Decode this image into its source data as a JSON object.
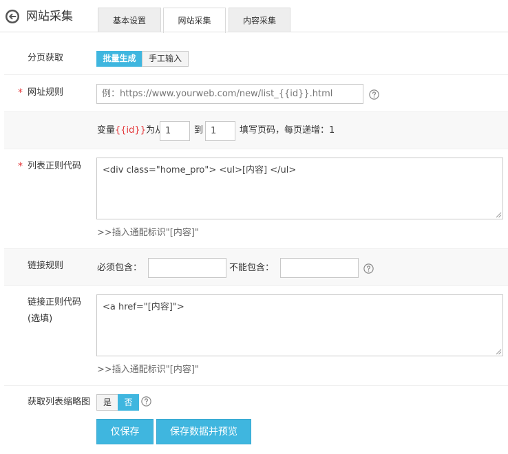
{
  "header": {
    "title": "网站采集",
    "tabs": [
      {
        "label": "基本设置"
      },
      {
        "label": "网站采集"
      },
      {
        "label": "内容采集"
      }
    ]
  },
  "paging": {
    "label": "分页获取",
    "options": [
      "批量生成",
      "手工输入"
    ],
    "selected": "批量生成"
  },
  "url_rule": {
    "required_mark": "*",
    "label": "网址规则",
    "placeholder": "例：https://www.yourweb.com/new/list_{{id}}.html"
  },
  "variable": {
    "prefix": "变量",
    "token": "{{id}}",
    "from_text": "为从",
    "from_value": "1",
    "to_text": "到",
    "to_value": "1",
    "suffix": "填写页码，每页递增：1"
  },
  "list_regex": {
    "required_mark": "*",
    "label": "列表正则代码",
    "value": "<div class=\"home_pro\"> <ul>[内容] </ul>",
    "hint": ">>插入通配标识\"[内容]\""
  },
  "link_rule": {
    "label": "链接规则",
    "must_include_label": "必须包含：",
    "must_include_value": "",
    "must_exclude_label": "不能包含：",
    "must_exclude_value": ""
  },
  "link_regex": {
    "label": "链接正则代码",
    "label_note": "(选填)",
    "value": "<a href=\"[内容]\">",
    "hint": ">>插入通配标识\"[内容]\""
  },
  "thumbnail": {
    "label": "获取列表缩略图",
    "options": [
      "是",
      "否"
    ],
    "selected": "否"
  },
  "actions": {
    "save_only": "仅保存",
    "save_preview": "保存数据并预览"
  },
  "colors": {
    "accent": "#3fb6df",
    "required": "#e4393c"
  }
}
